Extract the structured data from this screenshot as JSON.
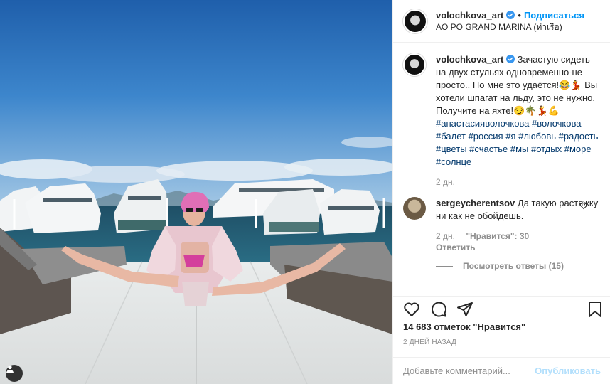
{
  "post": {
    "username": "volochkova_art",
    "follow_label": "Подписаться",
    "location": "AO PO GRAND MARINA (ท่าเรือ)",
    "caption_text": "Зачастую сидеть на двух стульях одновременно-не просто.. Но мне это удаётся!😂💃 Вы хотели шпагат на льду, это не нужно. Получите на яхте!😏🌴💃💪 ",
    "hashtags": [
      "#анастасияволочкова",
      "#волочкова",
      "#балет",
      "#россия",
      "#я",
      "#любовь",
      "#радость",
      "#цветы",
      "#счастье",
      "#мы",
      "#отдых",
      "#море",
      "#солнце"
    ],
    "caption_age": "2 дн.",
    "likes_text": "14 683 отметок \"Нравится\"",
    "date_text": "2 ДНЕЙ НАЗАД"
  },
  "comment": {
    "username": "sergeycherentsov",
    "text": "Да такую растяжку ни как не обойдешь.",
    "age": "2 дн.",
    "likes": "\"Нравится\": 30",
    "reply_label": "Ответить",
    "view_replies": "Посмотреть ответы (15)"
  },
  "composer": {
    "placeholder": "Добавьте комментарий...",
    "publish_label": "Опубликовать"
  },
  "icons": {
    "like": "heart-icon",
    "comment": "comment-icon",
    "share": "share-icon",
    "save": "bookmark-icon",
    "verified": "verified-badge-icon",
    "tag": "user-tag-icon"
  },
  "colors": {
    "link": "#0095f6",
    "hashtag": "#00376b",
    "muted": "#8e8e8e",
    "publish_disabled": "#b2dffc"
  }
}
